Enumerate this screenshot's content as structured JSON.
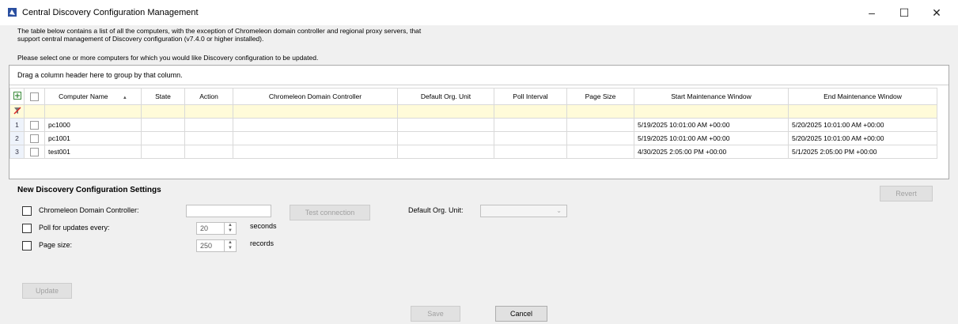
{
  "window": {
    "title": "Central Discovery Configuration Management",
    "minimize_glyph": "–",
    "maximize_glyph": "☐",
    "close_glyph": "✕"
  },
  "intro": {
    "line1": "The table below contains a list of all the computers, with the exception of Chromeleon domain controller and regional proxy servers, that",
    "line2": "support central management of Discovery configuration (v7.4.0 or higher installed).",
    "line3": "Please select one or more computers for which you would like Discovery configuration to be updated."
  },
  "grid": {
    "group_panel_text": "Drag a column header here to group by that column.",
    "columns": [
      "Computer Name",
      "State",
      "Action",
      "Chromeleon Domain Controller",
      "Default Org. Unit",
      "Poll Interval",
      "Page Size",
      "Start Maintenance Window",
      "End Maintenance Window"
    ],
    "sort_glyph": "▲",
    "rows": [
      {
        "num": "1",
        "name": "pc1000",
        "state": "",
        "action": "",
        "dc": "",
        "org": "",
        "poll": "",
        "page": "",
        "start": "5/19/2025 10:01:00 AM +00:00",
        "end": "5/20/2025 10:01:00 AM +00:00"
      },
      {
        "num": "2",
        "name": "pc1001",
        "state": "",
        "action": "",
        "dc": "",
        "org": "",
        "poll": "",
        "page": "",
        "start": "5/19/2025 10:01:00 AM +00:00",
        "end": "5/20/2025 10:01:00 AM +00:00"
      },
      {
        "num": "3",
        "name": "test001",
        "state": "",
        "action": "",
        "dc": "",
        "org": "",
        "poll": "",
        "page": "",
        "start": "4/30/2025 2:05:00 PM +00:00",
        "end": "5/1/2025 2:05:00 PM +00:00"
      }
    ]
  },
  "settings": {
    "title": "New Discovery Configuration Settings",
    "dc_label": "Chromeleon Domain Controller:",
    "dc_value": "",
    "test_connection": "Test connection",
    "org_unit_label": "Default Org. Unit:",
    "poll_label": "Poll for updates every:",
    "poll_value": "20",
    "poll_unit": "seconds",
    "page_label": "Page size:",
    "page_value": "250",
    "page_unit": "records",
    "revert": "Revert",
    "update": "Update"
  },
  "footer": {
    "save": "Save",
    "cancel": "Cancel"
  },
  "colors": {
    "filter_row": "#fffbd9",
    "row_header": "#eef3fb"
  }
}
